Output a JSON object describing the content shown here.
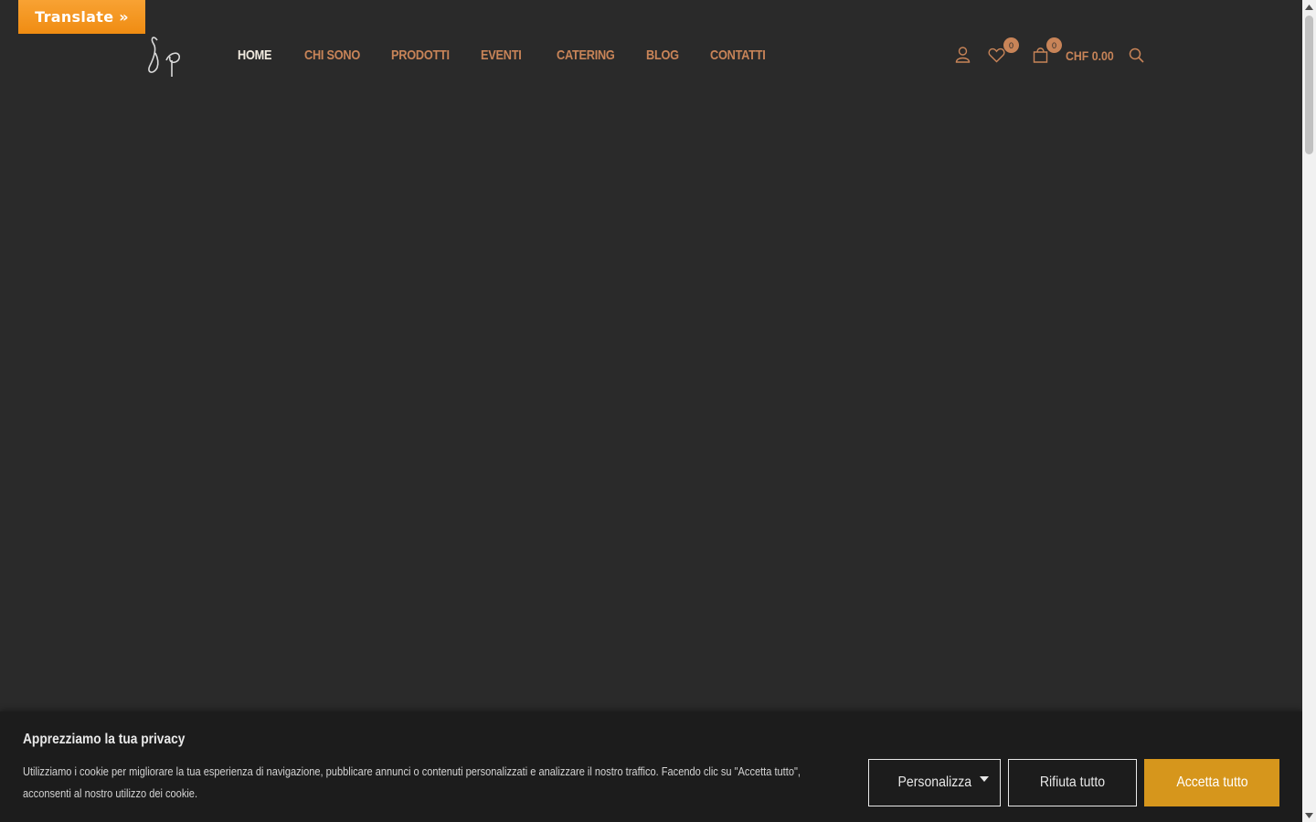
{
  "translate": {
    "label": "Translate »"
  },
  "nav": {
    "items": [
      {
        "label": "HOME",
        "active": true
      },
      {
        "label": "CHI SONO"
      },
      {
        "label": "PRODOTTI"
      },
      {
        "label": "EVENTI"
      },
      {
        "label": "CATERING"
      },
      {
        "label": "BLOG"
      },
      {
        "label": "CONTATTI"
      }
    ]
  },
  "header_icons": {
    "account": "user-icon",
    "wishlist": {
      "icon": "heart-icon",
      "count": "0"
    },
    "cart": {
      "icon": "bag-icon",
      "count": "0",
      "total": "CHF 0.00"
    },
    "search": "search-icon"
  },
  "cookie": {
    "title": "Apprezziamo la tua privacy",
    "text": "Utilizziamo i cookie per migliorare la tua esperienza di navigazione, pubblicare annunci o contenuti personalizzati e analizzare il nostro traffico. Facendo clic su \"Accetta tutto\", acconsenti al nostro utilizzo dei cookie.",
    "customize_label": "Personalizza",
    "reject_label": "Rifiuta tutto",
    "accept_label": "Accetta tutto"
  },
  "colors": {
    "background": "#2a2a2a",
    "accent": "#c88458",
    "accept_button": "#d6961c",
    "translate_button": "#f39a1f"
  }
}
